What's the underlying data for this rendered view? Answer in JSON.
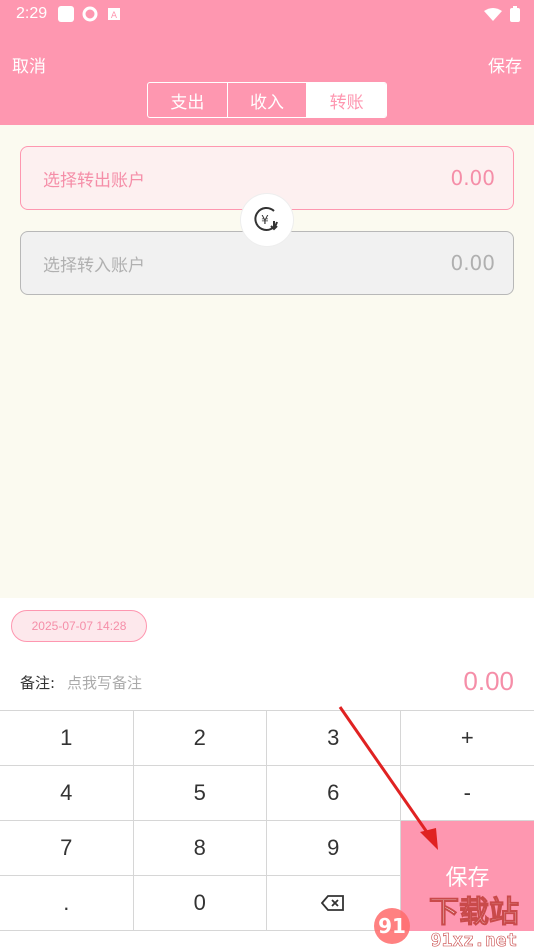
{
  "status": {
    "time": "2:29"
  },
  "header": {
    "cancel": "取消",
    "save": "保存",
    "tabs": [
      {
        "label": "支出"
      },
      {
        "label": "收入"
      },
      {
        "label": "转账"
      }
    ]
  },
  "transfer": {
    "out": {
      "placeholder": "选择转出账户",
      "amount": "0.00"
    },
    "in": {
      "placeholder": "选择转入账户",
      "amount": "0.00"
    }
  },
  "bottom": {
    "date": "2025-07-07 14:28",
    "note_label": "备注:",
    "note_placeholder": "点我写备注",
    "amount": "0.00"
  },
  "keypad": {
    "k1": "1",
    "k2": "2",
    "k3": "3",
    "plus": "+",
    "k4": "4",
    "k5": "5",
    "k6": "6",
    "minus": "-",
    "k7": "7",
    "k8": "8",
    "k9": "9",
    "dot": ".",
    "k0": "0",
    "save": "保存"
  },
  "colors": {
    "accent": "#fe97b0",
    "background": "#fbfaf0"
  },
  "watermark": {
    "text_cn": "下载站",
    "text_url": "91xz.net"
  }
}
